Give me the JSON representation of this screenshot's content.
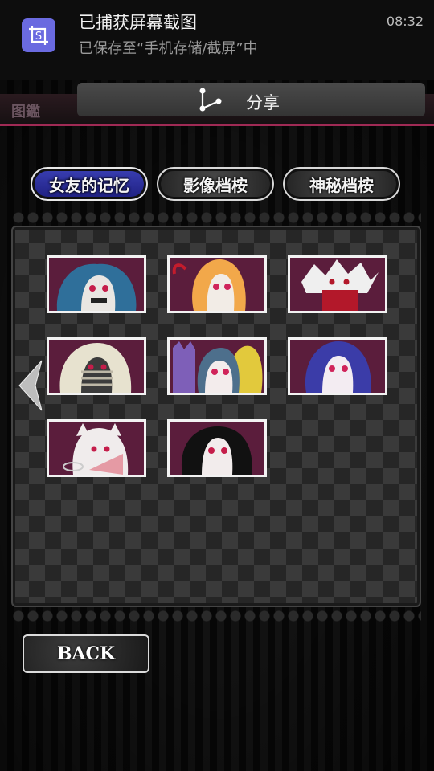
{
  "notification": {
    "icon": "screenshot-icon",
    "title": "已捕获屏幕截图",
    "subtitle": "已保存至“手机存储/截屏”中",
    "time": "08:32"
  },
  "header": {
    "title": "图鑑"
  },
  "share": {
    "icon": "share-icon",
    "label": "分享"
  },
  "tabs": [
    {
      "label": "女友的记忆",
      "active": true
    },
    {
      "label": "影像档桉",
      "active": false
    },
    {
      "label": "神秘档桉",
      "active": false
    }
  ],
  "gallery": {
    "items": [
      {
        "name": "blue-haired-girl-thumb"
      },
      {
        "name": "blonde-devil-girl-thumb"
      },
      {
        "name": "white-haired-red-scarf-thumb"
      },
      {
        "name": "bandaged-mummy-girl-thumb"
      },
      {
        "name": "cat-and-blonde-girl-thumb"
      },
      {
        "name": "purple-haired-girl-thumb"
      },
      {
        "name": "white-cat-girl-thumb"
      },
      {
        "name": "black-haired-girl-thumb"
      }
    ]
  },
  "nav": {
    "prev_icon": "chevron-left-icon"
  },
  "back": {
    "label": "BACK"
  },
  "colors": {
    "tab_active": "#2a2d9a",
    "accent_line": "#a02a55",
    "thumb_bg": "#5a1d3a"
  }
}
